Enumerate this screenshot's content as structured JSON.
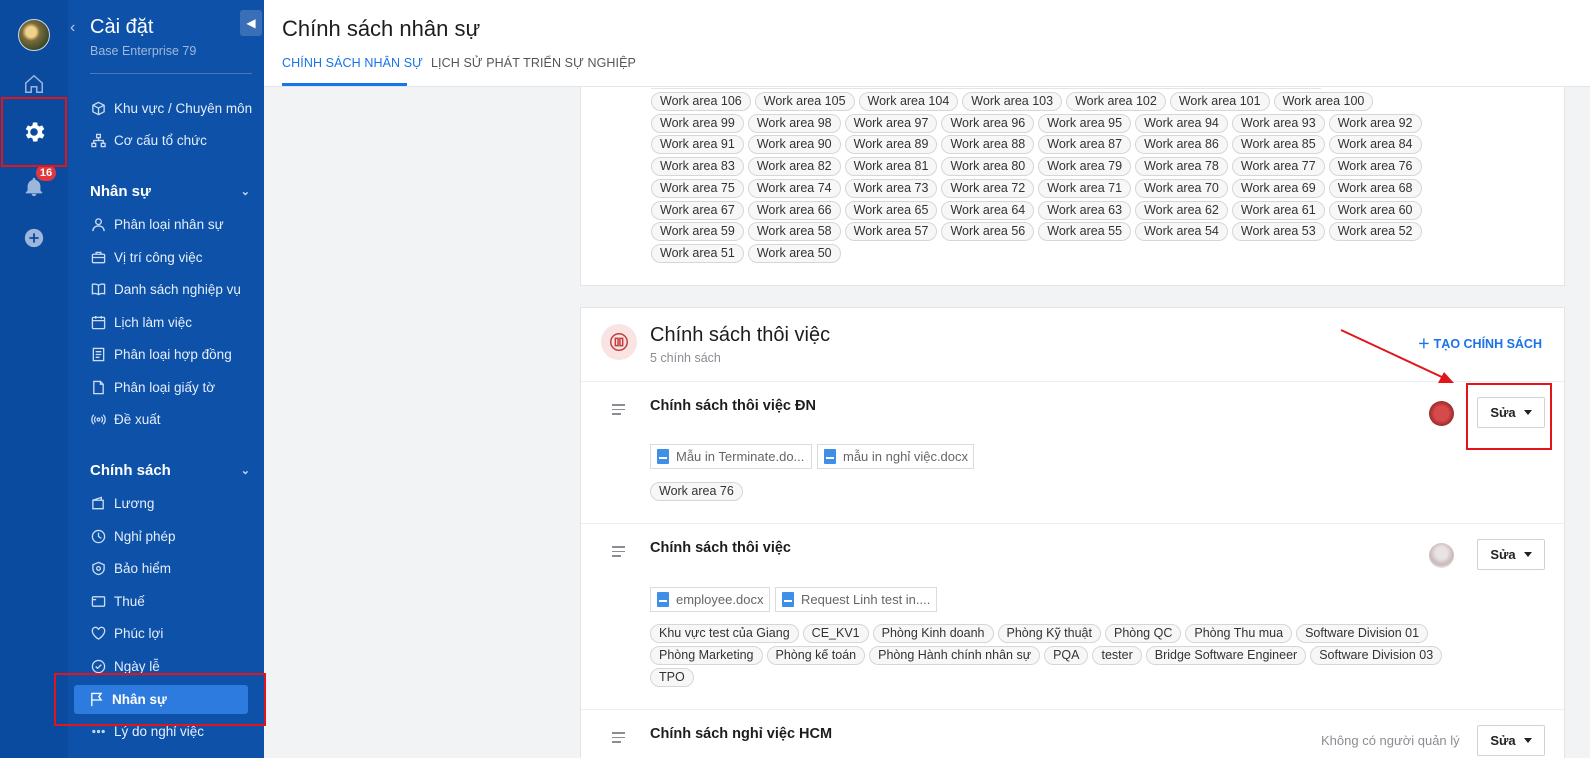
{
  "rail": {
    "badge_count": "16"
  },
  "sidebar": {
    "title": "Cài đặt",
    "subtitle": "Base Enterprise 79",
    "top_items": [
      {
        "label": "Khu vực / Chuyên môn",
        "icon": "cube-icon"
      },
      {
        "label": "Cơ cấu tổ chức",
        "icon": "org-chart-icon"
      }
    ],
    "section_hr": "Nhân sự",
    "hr_items": [
      {
        "label": "Phân loại nhân sự",
        "icon": "user-icon"
      },
      {
        "label": "Vị trí công việc",
        "icon": "briefcase-icon"
      },
      {
        "label": "Danh sách nghiệp vụ",
        "icon": "book-icon"
      },
      {
        "label": "Lịch làm việc",
        "icon": "calendar-icon"
      },
      {
        "label": "Phân loại hợp đồng",
        "icon": "contract-icon"
      },
      {
        "label": "Phân loại giấy tờ",
        "icon": "document-icon"
      },
      {
        "label": "Đề xuất",
        "icon": "broadcast-icon"
      }
    ],
    "section_policy": "Chính sách",
    "policy_items": [
      {
        "label": "Lương",
        "icon": "wallet-icon"
      },
      {
        "label": "Nghỉ phép",
        "icon": "clock-icon"
      },
      {
        "label": "Bảo hiểm",
        "icon": "shield-icon"
      },
      {
        "label": "Thuế",
        "icon": "tax-icon"
      },
      {
        "label": "Phúc lợi",
        "icon": "heart-icon"
      },
      {
        "label": "Ngày lễ",
        "icon": "check-circle-icon"
      }
    ],
    "active_item": "Nhân sự",
    "last_item": "Lý do nghỉ việc"
  },
  "header": {
    "title": "Chính sách nhân sự",
    "tabs": [
      "CHÍNH SÁCH NHÂN SỰ",
      "LỊCH SỬ PHÁT TRIỂN SỰ NGHIỆP"
    ]
  },
  "work_areas_panel": {
    "rows": [
      [
        "Work area 106",
        "Work area 105",
        "Work area 104",
        "Work area 103",
        "Work area 102",
        "Work area 101",
        "Work area 100"
      ],
      [
        "Work area 99",
        "Work area 98",
        "Work area 97",
        "Work area 96",
        "Work area 95",
        "Work area 94",
        "Work area 93",
        "Work area 92"
      ],
      [
        "Work area 91",
        "Work area 90",
        "Work area 89",
        "Work area 88",
        "Work area 87",
        "Work area 86",
        "Work area 85",
        "Work area 84"
      ],
      [
        "Work area 83",
        "Work area 82",
        "Work area 81",
        "Work area 80",
        "Work area 79",
        "Work area 78",
        "Work area 77",
        "Work area 76"
      ],
      [
        "Work area 75",
        "Work area 74",
        "Work area 73",
        "Work area 72",
        "Work area 71",
        "Work area 70",
        "Work area 69",
        "Work area 68"
      ],
      [
        "Work area 67",
        "Work area 66",
        "Work area 65",
        "Work area 64",
        "Work area 63",
        "Work area 62",
        "Work area 61",
        "Work area 60"
      ],
      [
        "Work area 59",
        "Work area 58",
        "Work area 57",
        "Work area 56",
        "Work area 55",
        "Work area 54",
        "Work area 53",
        "Work area 52"
      ],
      [
        "Work area 51",
        "Work area 50"
      ]
    ]
  },
  "resign_panel": {
    "title": "Chính sách thôi việc",
    "count": "5 chính sách",
    "create_label": "TẠO CHÍNH SÁCH",
    "policies": [
      {
        "title": "Chính sách thôi việc ĐN",
        "docs": [
          "Mẫu in Terminate.do...",
          "mẫu in nghỉ việc.docx"
        ],
        "tags": [
          "Work area 76"
        ],
        "edit_label": "Sửa"
      },
      {
        "title": "Chính sách thôi việc",
        "docs": [
          "employee.docx",
          "Request Linh test in...."
        ],
        "tags_row1": [
          "Khu vực test của Giang",
          "CE_KV1",
          "Phòng Kinh doanh",
          "Phòng Kỹ thuật",
          "Phòng QC",
          "Phòng Thu mua",
          "Software Division 01"
        ],
        "tags_row2": [
          "Phòng Marketing",
          "Phòng kế toán",
          "Phòng Hành chính nhân sự",
          "PQA",
          "tester",
          "Bridge Software Engineer",
          "Software Division 03"
        ],
        "tags_row3": [
          "TPO"
        ],
        "edit_label": "Sửa"
      },
      {
        "title": "Chính sách nghỉ việc HCM",
        "manager_text": "Không có người quản lý",
        "edit_label": "Sửa"
      }
    ]
  },
  "colors": {
    "rail": "#0a4a9f",
    "sidebar": "#0d52a8",
    "accent": "#1a73e8",
    "annotation": "#e2151b"
  }
}
